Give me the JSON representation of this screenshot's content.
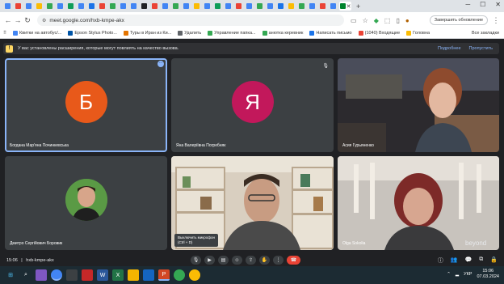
{
  "browser": {
    "url": "meet.google.com/hxb-kmpe-akx",
    "update_button": "Завершить обновление",
    "tabs": [
      {
        "color": "#4285f4"
      },
      {
        "color": "#ea4335"
      },
      {
        "color": "#4285f4"
      },
      {
        "color": "#fbbc04"
      },
      {
        "color": "#34a853"
      },
      {
        "color": "#4285f4"
      },
      {
        "color": "#0f9d58"
      },
      {
        "color": "#4285f4"
      },
      {
        "color": "#1a73e8"
      },
      {
        "color": "#ea4335"
      },
      {
        "color": "#34a853"
      },
      {
        "color": "#4285f4"
      },
      {
        "color": "#4285f4"
      },
      {
        "color": "#202124"
      },
      {
        "color": "#ea4335"
      },
      {
        "color": "#4285f4"
      },
      {
        "color": "#34a853"
      },
      {
        "color": "#4285f4"
      },
      {
        "color": "#fbbc04"
      },
      {
        "color": "#4285f4"
      },
      {
        "color": "#0f9d58"
      },
      {
        "color": "#4285f4"
      },
      {
        "color": "#ea4335"
      },
      {
        "color": "#4285f4"
      },
      {
        "color": "#34a853"
      },
      {
        "color": "#4285f4"
      },
      {
        "color": "#1a73e8"
      },
      {
        "color": "#fbbc04"
      },
      {
        "color": "#34a853"
      },
      {
        "color": "#4285f4"
      },
      {
        "color": "#ea4335"
      },
      {
        "color": "#4285f4"
      }
    ],
    "active_tab_color": "#00832d",
    "bookmarks": [
      {
        "label": "Квитки на автобус/...",
        "color": "#4285f4"
      },
      {
        "label": "Epson Stylus Photo...",
        "color": "#0054a6"
      },
      {
        "label": "Туры в Иран из Ки...",
        "color": "#e37400"
      },
      {
        "label": "Удалить",
        "color": "#5f6368"
      },
      {
        "label": "Управление папка...",
        "color": "#34a853"
      },
      {
        "label": "анютка керевник",
        "color": "#34a853"
      },
      {
        "label": "Написать письмо",
        "color": "#1a73e8"
      },
      {
        "label": "(1040) Входящие",
        "color": "#ea4335"
      },
      {
        "label": "Головна",
        "color": "#fbbc04"
      }
    ],
    "all_bookmarks": "Все закладки"
  },
  "notice": {
    "text": "У вас установлены расширения, которые могут повлиять на качество вызова.",
    "action_details": "Подробнее",
    "action_skip": "Пропустить"
  },
  "participants": [
    {
      "name": "Богдана Мар'яна Починкевська",
      "initial": "Б",
      "avatar_color": "#e8591a",
      "type": "avatar"
    },
    {
      "name": "Яна Валеріївна Погребняк",
      "initial": "Я",
      "avatar_color": "#c2185b",
      "type": "avatar"
    },
    {
      "name": "Асия Гурьяненко",
      "type": "video"
    },
    {
      "name": "Дмитро Сергійович Боровик",
      "type": "photo"
    },
    {
      "name": "",
      "type": "video"
    },
    {
      "name": "Olga Sokolia",
      "type": "video"
    }
  ],
  "tooltip": {
    "line1": "Выключить микрофон",
    "line2": "(Ctrl + D)"
  },
  "bottombar": {
    "time": "15:06",
    "separator": "|",
    "meeting_code": "hxb-kmpe-akx"
  },
  "taskbar": {
    "language": "УКР",
    "time": "15:06",
    "date": "07.03.2024"
  }
}
